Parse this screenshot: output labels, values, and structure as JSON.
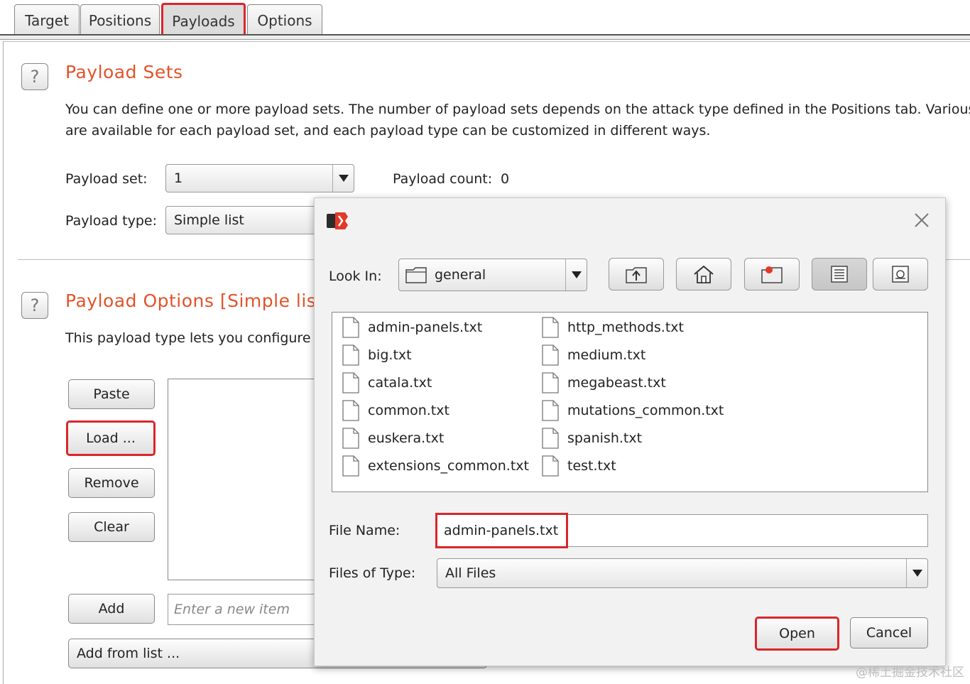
{
  "tabs": [
    {
      "label": "Target"
    },
    {
      "label": "Positions"
    },
    {
      "label": "Payloads"
    },
    {
      "label": "Options"
    }
  ],
  "payload_sets": {
    "title": "Payload Sets",
    "description_line1": "You can define one or more payload sets. The number of payload sets depends on the attack type defined in the Positions tab. Various",
    "description_line2": "are available for each payload set, and each payload type can be customized in different ways.",
    "set_label": "Payload set:",
    "set_value": "1",
    "count_label": "Payload count:",
    "count_value": "0",
    "type_label": "Payload type:",
    "type_value": "Simple list"
  },
  "payload_options": {
    "title": "Payload Options [Simple list",
    "description": "This payload type lets you configure",
    "buttons": {
      "paste": "Paste",
      "load": "Load ...",
      "remove": "Remove",
      "clear": "Clear",
      "add": "Add",
      "add_from_list": "Add from list ..."
    },
    "new_item_placeholder": "Enter a new item"
  },
  "dialog": {
    "look_in_label": "Look In:",
    "look_in_value": "general",
    "files_left": [
      "admin-panels.txt",
      "big.txt",
      "catala.txt",
      "common.txt",
      "euskera.txt",
      "extensions_common.txt"
    ],
    "files_right": [
      "http_methods.txt",
      "medium.txt",
      "megabeast.txt",
      "mutations_common.txt",
      "spanish.txt",
      "test.txt"
    ],
    "file_name_label": "File Name:",
    "file_name_value": "admin-panels.txt",
    "file_type_label": "Files of Type:",
    "file_type_value": "All Files",
    "open_label": "Open",
    "cancel_label": "Cancel"
  },
  "watermark": "@稀土掘金技术社区",
  "colors": {
    "title_accent": "#e2532a",
    "highlight_box": "#d9262b"
  }
}
